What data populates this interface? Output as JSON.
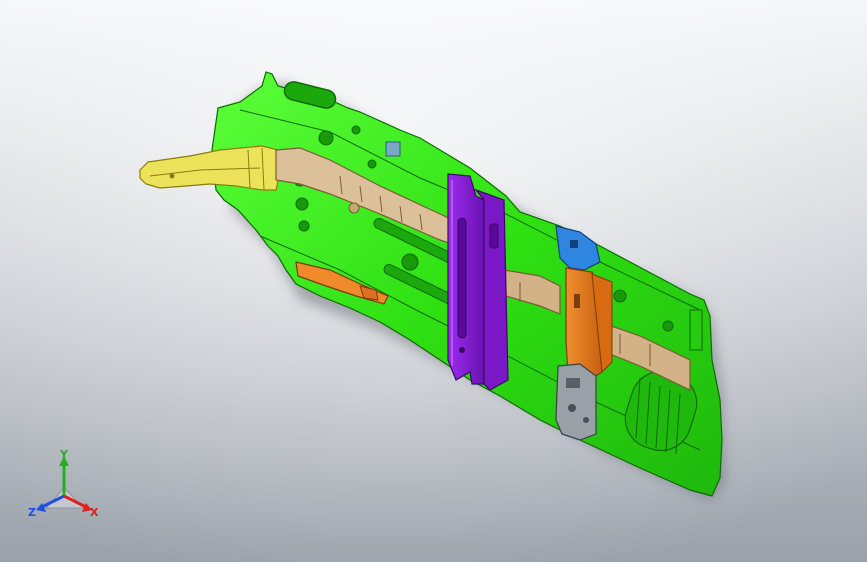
{
  "viewport": {
    "background_top": "#f4f5f7",
    "background_bottom": "#9aa1aa"
  },
  "model": {
    "parts": [
      {
        "name": "main-panel",
        "color": "#33ee11"
      },
      {
        "name": "yellow-bracket",
        "color": "#e8e04a"
      },
      {
        "name": "wood-rail",
        "color": "#d8b888"
      },
      {
        "name": "purple-bracket",
        "color": "#8a1ad6"
      },
      {
        "name": "orange-bracket",
        "color": "#e27a1a"
      },
      {
        "name": "blue-clip",
        "color": "#2f86e0"
      },
      {
        "name": "gray-block",
        "color": "#8a8f98"
      }
    ]
  },
  "triad": {
    "x_label": "X",
    "y_label": "Y",
    "z_label": "Z",
    "x_color": "#e0201b",
    "y_color": "#20b020",
    "z_color": "#1f4fe0"
  }
}
